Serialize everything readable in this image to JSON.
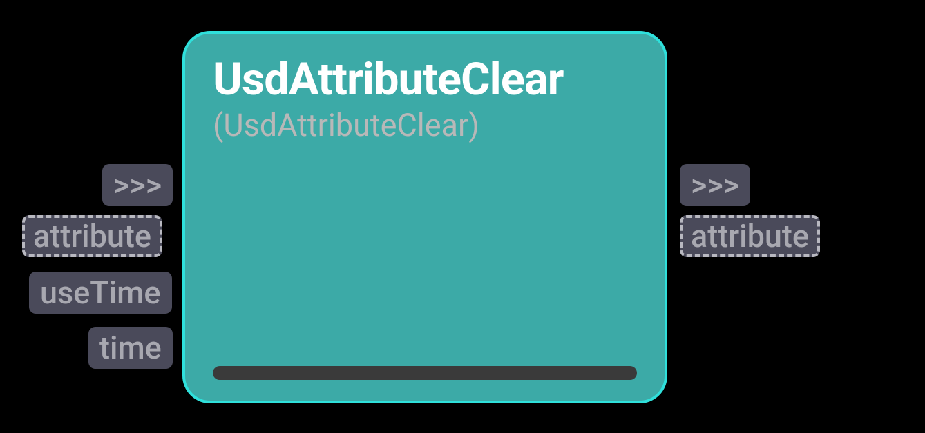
{
  "node": {
    "title": "UsdAttributeClear",
    "subtitle": "(UsdAttributeClear)"
  },
  "inputs": {
    "exec": ">>>",
    "attribute": "attribute",
    "useTime": "useTime",
    "time": "time"
  },
  "outputs": {
    "exec": ">>>",
    "attribute": "attribute"
  }
}
